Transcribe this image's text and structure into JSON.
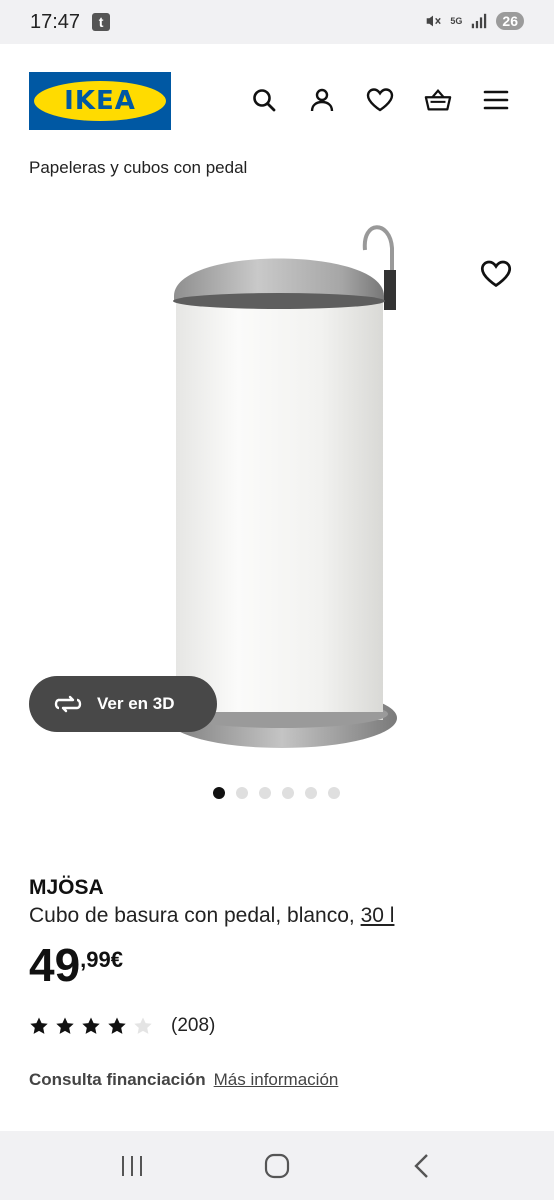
{
  "status_bar": {
    "time": "17:47",
    "app_badge": "t",
    "network": "5G",
    "battery": "26"
  },
  "header": {
    "logo_text": "IKEA",
    "icons": [
      "search-icon",
      "user-icon",
      "heart-icon",
      "basket-icon",
      "menu-icon"
    ],
    "colors": {
      "logo_blue": "#0058a3",
      "logo_yellow": "#ffdb00"
    }
  },
  "breadcrumb": "Papeleras y cubos con pedal",
  "gallery": {
    "view3d_label": "Ver en 3D",
    "dots_count": 6,
    "active_dot": 1
  },
  "product": {
    "name": "MJÖSA",
    "description": "Cubo de basura con pedal, blanco,",
    "size": "30 l",
    "price_int": "49",
    "price_dec": ",99",
    "currency": "€",
    "rating": 4,
    "rating_max": 5,
    "reviews": "(208)"
  },
  "financing": {
    "label": "Consulta financiación",
    "link": "Más información"
  }
}
